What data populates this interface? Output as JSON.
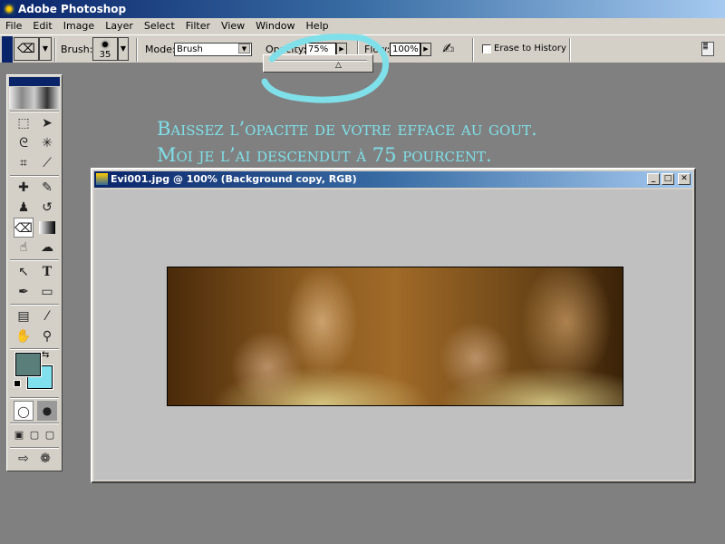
{
  "app": {
    "title": "Adobe Photoshop"
  },
  "menu": [
    "File",
    "Edit",
    "Image",
    "Layer",
    "Select",
    "Filter",
    "View",
    "Window",
    "Help"
  ],
  "options": {
    "brush_label": "Brush:",
    "brush_size": "35",
    "mode_label": "Mode:",
    "mode_value": "Brush",
    "opacity_label": "Opacity:",
    "opacity_value": "75%",
    "flow_label": "Flow:",
    "flow_value": "100%",
    "erase_history_label": "Erase to History",
    "erase_history_checked": false
  },
  "toolbox": {
    "foreground_color": "#5a7f7a",
    "background_color": "#80e0ee",
    "active_tool": "eraser"
  },
  "annotation": {
    "line1": "Baissez l’opacite de votre efface au gout.",
    "line2": "Moi je l’ai descendut à 75 pourcent.",
    "color": "#7fe0ea"
  },
  "document": {
    "title": "Evi001.jpg @ 100% (Background copy, RGB)"
  }
}
